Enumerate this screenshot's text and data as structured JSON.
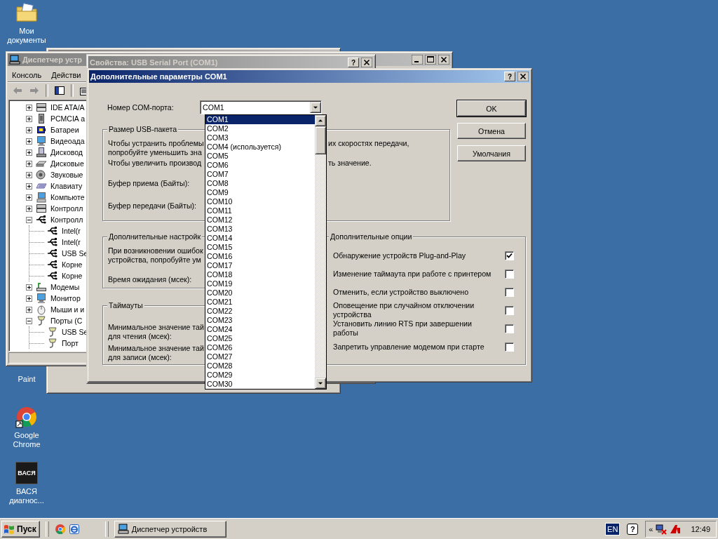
{
  "desktop": {
    "icons": [
      {
        "label": "Мои документы",
        "kind": "folder"
      },
      {
        "label": "Paint",
        "kind": "covered"
      },
      {
        "label": "Google Chrome",
        "kind": "chrome"
      },
      {
        "label": "ВАСЯ диагнос...",
        "kind": "app",
        "icon_text": "ВАСЯ"
      }
    ]
  },
  "device_manager": {
    "title": "Диспетчер устр",
    "menu": [
      "Консоль",
      "Действи"
    ],
    "tree": [
      {
        "label": "IDE ATA/A",
        "kind": "ide",
        "expanded": false
      },
      {
        "label": "PCMCIA a",
        "kind": "pcmcia",
        "expanded": false
      },
      {
        "label": "Батареи",
        "kind": "battery",
        "expanded": false
      },
      {
        "label": "Видеоада",
        "kind": "display",
        "expanded": false
      },
      {
        "label": "Дисковод",
        "kind": "floppy",
        "expanded": false
      },
      {
        "label": "Дисковые",
        "kind": "disk",
        "expanded": false
      },
      {
        "label": "Звуковые",
        "kind": "sound",
        "expanded": false
      },
      {
        "label": "Клавиату",
        "kind": "keyboard",
        "expanded": false
      },
      {
        "label": "Компьюте",
        "kind": "computer",
        "expanded": false
      },
      {
        "label": "Контролл",
        "kind": "ide",
        "expanded": false
      },
      {
        "label": "Контролл",
        "kind": "usb",
        "expanded": true,
        "children": [
          {
            "label": "Intel(r",
            "kind": "usb"
          },
          {
            "label": "Intel(r",
            "kind": "usb"
          },
          {
            "label": "USB Se",
            "kind": "usb"
          },
          {
            "label": "Корне",
            "kind": "usb"
          },
          {
            "label": "Корне",
            "kind": "usb"
          }
        ]
      },
      {
        "label": "Модемы",
        "kind": "modem",
        "expanded": false
      },
      {
        "label": "Монитор",
        "kind": "display",
        "expanded": false
      },
      {
        "label": "Мыши и и",
        "kind": "mouse",
        "expanded": false
      },
      {
        "label": "Порты (C",
        "kind": "port",
        "expanded": true,
        "children": [
          {
            "label": "USB Se",
            "kind": "port"
          },
          {
            "label": "Порт",
            "kind": "port"
          }
        ]
      }
    ]
  },
  "properties_window": {
    "title": "Свойства: USB Serial Port (COM1)",
    "help_button": "?"
  },
  "dialog": {
    "title": "Дополнительные параметры COM1",
    "help_button": "?",
    "port_label": "Номер COM-порта:",
    "port_value": "COM1",
    "port_list": [
      {
        "label": "COM1",
        "selected": true
      },
      {
        "label": "COM2",
        "selected": false
      },
      {
        "label": "COM3",
        "selected": false
      },
      {
        "label": "COM4 (используется)",
        "selected": false
      },
      {
        "label": "COM5",
        "selected": false
      },
      {
        "label": "COM6",
        "selected": false
      },
      {
        "label": "COM7",
        "selected": false
      },
      {
        "label": "COM8",
        "selected": false
      },
      {
        "label": "COM9",
        "selected": false
      },
      {
        "label": "COM10",
        "selected": false
      },
      {
        "label": "COM11",
        "selected": false
      },
      {
        "label": "COM12",
        "selected": false
      },
      {
        "label": "COM13",
        "selected": false
      },
      {
        "label": "COM14",
        "selected": false
      },
      {
        "label": "COM15",
        "selected": false
      },
      {
        "label": "COM16",
        "selected": false
      },
      {
        "label": "COM17",
        "selected": false
      },
      {
        "label": "COM18",
        "selected": false
      },
      {
        "label": "COM19",
        "selected": false
      },
      {
        "label": "COM20",
        "selected": false
      },
      {
        "label": "COM21",
        "selected": false
      },
      {
        "label": "COM22",
        "selected": false
      },
      {
        "label": "COM23",
        "selected": false
      },
      {
        "label": "COM24",
        "selected": false
      },
      {
        "label": "COM25",
        "selected": false
      },
      {
        "label": "COM26",
        "selected": false
      },
      {
        "label": "COM27",
        "selected": false
      },
      {
        "label": "COM28",
        "selected": false
      },
      {
        "label": "COM29",
        "selected": false
      },
      {
        "label": "COM30",
        "selected": false
      }
    ],
    "usb_group": {
      "title": "Размер USB-пакета",
      "lines": [
        {
          "left": "Чтобы устранить проблемы",
          "right": "их скоростях передачи,"
        },
        {
          "left": "попробуйте уменьшить зна"
        },
        {
          "left": "Чтобы увеличить производ",
          "right": "ть значение."
        }
      ],
      "receive_label": "Буфер приема (Байты):",
      "transmit_label": "Буфер передачи (Байты):"
    },
    "settings_group": {
      "title": "Дополнительные настройк",
      "text": "При возникновении ошибок\nустройства, попробуйте ум",
      "timeout_label": "Время ожидания (мсек):"
    },
    "timeouts_group": {
      "title": "Таймауты",
      "read_label": "Минимальное значение тай\nдля чтения (мсек):",
      "write_label": "Минимальное значение тай\nдля записи (мсек):"
    },
    "options_group": {
      "title": "Дополнительные опции",
      "options": [
        {
          "label": "Обнаружение устройств Plug-and-Play",
          "checked": true
        },
        {
          "label": "Изменение таймаута при работе с принтером",
          "checked": false
        },
        {
          "label": "Отменить, если устройство выключено",
          "checked": false
        },
        {
          "label": "Оповещение при случайном отключении\nустройства",
          "checked": false
        },
        {
          "label": "Установить линию RTS при завершении\nработы",
          "checked": false
        },
        {
          "label": "Запретить управление модемом при старте",
          "checked": false
        }
      ]
    },
    "buttons": [
      {
        "label": "OK",
        "default": true
      },
      {
        "label": "Отмена",
        "default": false
      },
      {
        "label": "Умолчания",
        "default": false
      }
    ]
  },
  "taskbar": {
    "start": "Пуск",
    "tasks": [
      {
        "label": "Диспетчер устройств"
      }
    ],
    "language": "EN",
    "help": "?",
    "tray_expand": "«",
    "clock": "12:49"
  }
}
